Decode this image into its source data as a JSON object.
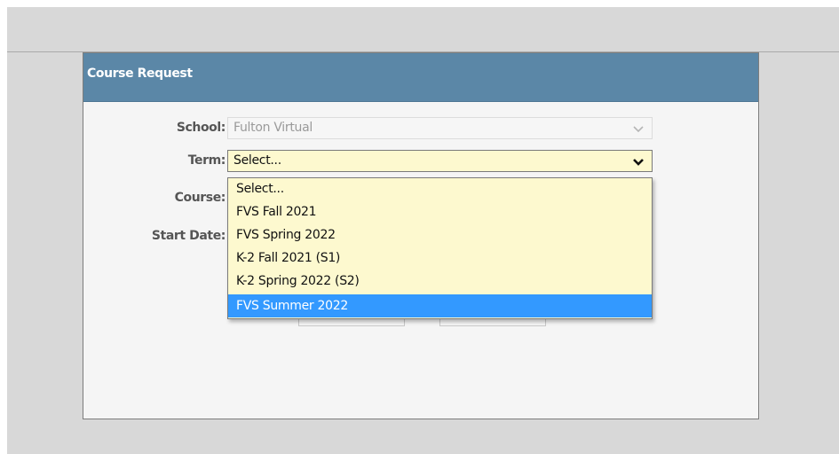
{
  "dialog": {
    "title": "Course Request"
  },
  "form": {
    "school": {
      "label": "School:",
      "value": "Fulton Virtual",
      "disabled": true
    },
    "term": {
      "label": "Term:",
      "value": "Select..."
    },
    "course": {
      "label": "Course:"
    },
    "start_date": {
      "label": "Start Date:"
    }
  },
  "term_dropdown": {
    "options": [
      {
        "label": "Select..."
      },
      {
        "label": "FVS Fall 2021"
      },
      {
        "label": "FVS Spring 2022"
      },
      {
        "label": "K-2 Fall 2021 (S1)"
      },
      {
        "label": "K-2 Spring 2022 (S2)"
      },
      {
        "label": "FVS Summer 2022",
        "highlighted": true
      }
    ]
  },
  "colors": {
    "header": "#5b87a7",
    "field_background": "#fdf9cf",
    "highlight": "#3399ff",
    "panel": "#f5f5f5",
    "backdrop": "#d8d8d8"
  },
  "icons": {
    "school_select": "chevron-down-icon",
    "term_select": "chevron-down-icon"
  }
}
